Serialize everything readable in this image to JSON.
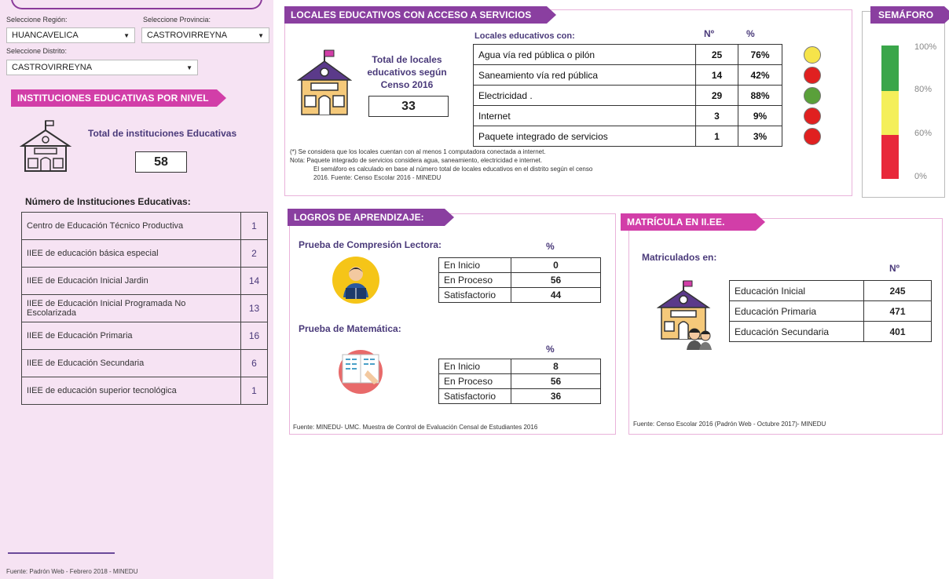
{
  "filters": {
    "region_label": "Seleccione Región:",
    "region_value": "HUANCAVELICA",
    "province_label": "Seleccione Provincia:",
    "province_value": "CASTROVIRREYNA",
    "district_label": "Seleccione Distrito:",
    "district_value": "CASTROVIRREYNA"
  },
  "instituciones": {
    "banner": "INSTITUCIONES EDUCATIVAS POR NIVEL",
    "total_label": "Total de instituciones Educativas",
    "total_value": "58",
    "list_title": "Número de Instituciones Educativas:",
    "rows": [
      {
        "name": "Centro de Educación Técnico Productiva",
        "count": "1"
      },
      {
        "name": "IIEE de educación básica especial",
        "count": "2"
      },
      {
        "name": "IIEE de Educación Inicial Jardin",
        "count": "14"
      },
      {
        "name": "IIEE de Educación Inicial Programada No Escolarizada",
        "count": "13"
      },
      {
        "name": "IIEE de Educación Primaria",
        "count": "16"
      },
      {
        "name": "IIEE de Educación Secundaria",
        "count": "6"
      },
      {
        "name": "IIEE de educación superior tecnológica",
        "count": "1"
      }
    ],
    "source": "Fuente: Padrón Web - Febrero 2018 - MINEDU"
  },
  "locales": {
    "banner": "LOCALES EDUCATIVOS CON ACCESO A SERVICIOS",
    "total_label": "Total de locales educativos según Censo 2016",
    "total_value": "33",
    "table_title": "Locales educativos con:",
    "col_num": "Nº",
    "col_pct": "%",
    "rows": [
      {
        "label": "Agua vía red pública o pilón",
        "num": "25",
        "pct": "76%",
        "color": "#f6e44a"
      },
      {
        "label": "Saneamiento vía red pública",
        "num": "14",
        "pct": "42%",
        "color": "#e02020"
      },
      {
        "label": "Electricidad .",
        "num": "29",
        "pct": "88%",
        "color": "#5aa03a"
      },
      {
        "label": "Internet",
        "num": "3",
        "pct": "9%",
        "color": "#e02020"
      },
      {
        "label": "Paquete integrado de servicios",
        "num": "1",
        "pct": "3%",
        "color": "#e02020"
      }
    ],
    "note1": "(*) Se considera que los locales cuentan con al menos 1 computadora conectada a internet.",
    "note2": "Nota: Paquete integrado de servicios considera agua, saneamiento, electricidad e internet.",
    "note3": "El semáforo es calculado en base al número total de locales educativos en el distrito según el censo",
    "note4": "2016. Fuente: Censo Escolar 2016 - MINEDU"
  },
  "semaforo": {
    "banner": "SEMÁFORO",
    "labels": [
      "100%",
      "80%",
      "60%",
      "0%"
    ],
    "colors": {
      "green": "#3aa64a",
      "yellow": "#f4ef5a",
      "red": "#e8283a"
    }
  },
  "logros": {
    "banner": "LOGROS DE APRENDIZAJE:",
    "lectora_title": "Prueba de Compresión Lectora:",
    "matematica_title": "Prueba de Matemática:",
    "pct_header": "%",
    "lectora": [
      {
        "label": "En Inicio",
        "value": "0"
      },
      {
        "label": "En Proceso",
        "value": "56"
      },
      {
        "label": "Satisfactorio",
        "value": "44"
      }
    ],
    "matematica": [
      {
        "label": "En Inicio",
        "value": "8"
      },
      {
        "label": "En Proceso",
        "value": "56"
      },
      {
        "label": "Satisfactorio",
        "value": "36"
      }
    ],
    "source": "Fuente: MINEDU- UMC. Muestra de Control de Evaluación Censal de Estudiantes 2016"
  },
  "matricula": {
    "banner": "MATRÍCULA EN II.EE.",
    "title": "Matriculados en:",
    "col_num": "Nº",
    "rows": [
      {
        "label": "Educación Inicial",
        "value": "245"
      },
      {
        "label": "Educación Primaria",
        "value": "471"
      },
      {
        "label": "Educación Secundaria",
        "value": "401"
      }
    ],
    "source": "Fuente: Censo Escolar 2016 (Padrón Web - Octubre 2017)- MINEDU"
  }
}
